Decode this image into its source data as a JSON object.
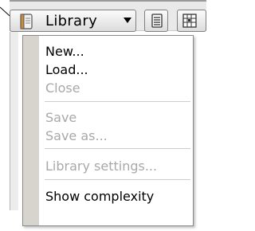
{
  "toolbar": {
    "library_label": "Library",
    "library_icon": "library-book-icon",
    "button_icons": [
      "database-icon",
      "grid-table-icon"
    ]
  },
  "menu": {
    "items": [
      {
        "label": "New...",
        "enabled": true
      },
      {
        "label": "Load...",
        "enabled": true
      },
      {
        "label": "Close",
        "enabled": false
      },
      {
        "label": "Save",
        "enabled": false
      },
      {
        "label": "Save as...",
        "enabled": false
      },
      {
        "label": "Library settings...",
        "enabled": false
      },
      {
        "label": "Show complexity",
        "enabled": true
      }
    ]
  }
}
